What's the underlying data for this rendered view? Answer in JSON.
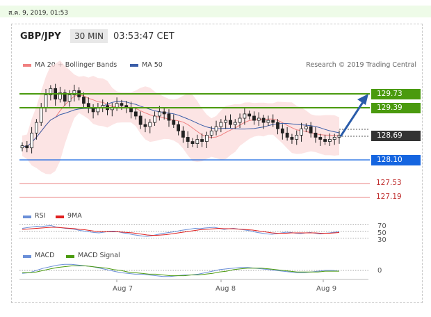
{
  "timestamp": "ส.ค. 9, 2019, 01:53",
  "header": {
    "symbol": "GBP/JPY",
    "timeframe": "30 MIN",
    "clock": "03:53:47 CET"
  },
  "legend": {
    "ma20_label": "MA 20 + Bollinger Bands",
    "ma50_label": "MA 50",
    "research": "Research © 2019 Trading Central",
    "ma20_color": "#f08080",
    "ma50_color": "#3b5ea8"
  },
  "rsi_legend": {
    "rsi": "RSI",
    "ma": "9MA"
  },
  "macd_legend": {
    "macd": "MACD",
    "signal": "MACD Signal"
  },
  "colors": {
    "green": "#4a9a0e",
    "blue": "#1565e0",
    "red": "#e05a5a",
    "dark": "#333333",
    "arrow": "#2a5caa"
  },
  "chart_data": [
    {
      "type": "candlestick",
      "title": "",
      "x": [
        "Aug 7",
        "Aug 8",
        "Aug 9"
      ],
      "ylim": [
        127.0,
        130.1
      ],
      "close_series": [
        128.4,
        128.35,
        128.7,
        128.95,
        129.3,
        129.6,
        129.75,
        129.5,
        129.65,
        129.45,
        129.6,
        129.7,
        129.55,
        129.4,
        129.3,
        129.2,
        129.3,
        129.35,
        129.25,
        129.3,
        129.4,
        129.35,
        129.3,
        129.2,
        129.1,
        128.9,
        128.85,
        128.95,
        129.1,
        129.2,
        129.15,
        129.0,
        128.9,
        128.75,
        128.6,
        128.5,
        128.45,
        128.55,
        128.5,
        128.65,
        128.75,
        128.85,
        128.95,
        129.0,
        128.9,
        128.95,
        129.05,
        129.15,
        129.1,
        129.0,
        129.05,
        128.95,
        129.0,
        128.95,
        128.8,
        128.7,
        128.6,
        128.55,
        128.65,
        128.8,
        128.85,
        128.7,
        128.6,
        128.55,
        128.5,
        128.55,
        128.6,
        128.65
      ],
      "levels": [
        {
          "value": "129.73",
          "kind": "resistance"
        },
        {
          "value": "129.39",
          "kind": "resistance"
        },
        {
          "value": "128.69",
          "kind": "last"
        },
        {
          "value": "128.10",
          "kind": "support"
        },
        {
          "value": "127.53",
          "kind": "support"
        },
        {
          "value": "127.19",
          "kind": "support"
        }
      ]
    },
    {
      "type": "line",
      "title": "RSI",
      "y_ticks": [
        "70",
        "50",
        "30"
      ],
      "ylim": [
        25,
        75
      ],
      "rsi": [
        58,
        60,
        62,
        64,
        63,
        65,
        66,
        62,
        60,
        58,
        57,
        55,
        52,
        50,
        48,
        46,
        45,
        47,
        49,
        50,
        48,
        45,
        43,
        40,
        38,
        36,
        35,
        37,
        40,
        43,
        45,
        47,
        49,
        52,
        54,
        56,
        58,
        57,
        59,
        60,
        61,
        58,
        55,
        57,
        58,
        56,
        54,
        52,
        49,
        46,
        44,
        42,
        41,
        43,
        45,
        47,
        46,
        44,
        43,
        45,
        46,
        44,
        42,
        44,
        45,
        47,
        48
      ],
      "ma9": [
        55,
        56,
        57,
        58,
        59,
        60,
        61,
        61,
        60,
        59,
        58,
        57,
        55,
        54,
        52,
        50,
        49,
        48,
        48,
        48,
        48,
        47,
        46,
        45,
        43,
        41,
        39,
        38,
        38,
        39,
        40,
        42,
        44,
        46,
        48,
        50,
        52,
        54,
        55,
        56,
        57,
        58,
        57,
        57,
        57,
        56,
        55,
        54,
        53,
        51,
        49,
        47,
        45,
        44,
        44,
        44,
        45,
        45,
        45,
        45,
        45,
        45,
        44,
        44,
        44,
        45,
        46
      ]
    },
    {
      "type": "line",
      "title": "MACD",
      "y_ticks": [
        "0"
      ],
      "ylim": [
        -0.12,
        0.12
      ],
      "macd": [
        -0.04,
        -0.03,
        0.0,
        0.03,
        0.05,
        0.07,
        0.08,
        0.08,
        0.07,
        0.06,
        0.05,
        0.03,
        0.01,
        -0.01,
        -0.03,
        -0.04,
        -0.05,
        -0.05,
        -0.06,
        -0.07,
        -0.08,
        -0.08,
        -0.07,
        -0.06,
        -0.06,
        -0.05,
        -0.03,
        -0.01,
        0.01,
        0.02,
        0.03,
        0.04,
        0.04,
        0.03,
        0.02,
        0.01,
        0.0,
        -0.01,
        -0.02,
        -0.03,
        -0.03,
        -0.02,
        -0.01,
        0.0,
        0.0,
        -0.01
      ],
      "signal": [
        -0.03,
        -0.03,
        -0.02,
        0.0,
        0.02,
        0.04,
        0.05,
        0.06,
        0.06,
        0.06,
        0.05,
        0.04,
        0.03,
        0.01,
        0.0,
        -0.02,
        -0.03,
        -0.04,
        -0.05,
        -0.05,
        -0.06,
        -0.07,
        -0.07,
        -0.07,
        -0.06,
        -0.06,
        -0.05,
        -0.04,
        -0.02,
        -0.01,
        0.01,
        0.02,
        0.03,
        0.03,
        0.03,
        0.02,
        0.01,
        0.0,
        -0.01,
        -0.02,
        -0.02,
        -0.02,
        -0.02,
        -0.01,
        -0.01,
        -0.01
      ]
    }
  ]
}
